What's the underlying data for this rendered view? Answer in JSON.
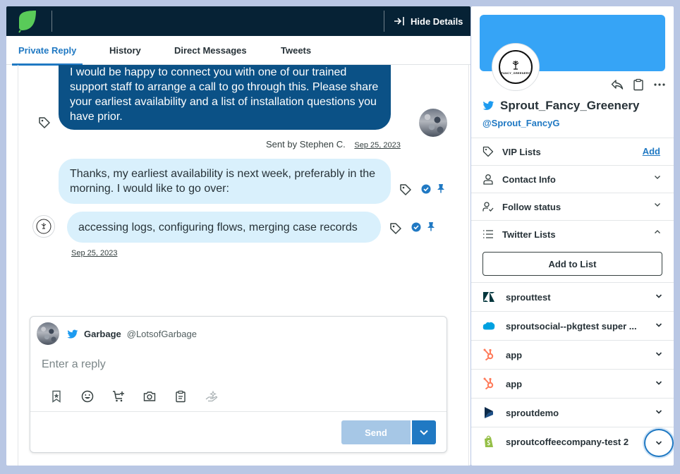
{
  "topbar": {
    "hide_details": "Hide Details"
  },
  "tabs": [
    {
      "label": "Private Reply",
      "active": true
    },
    {
      "label": "History"
    },
    {
      "label": "Direct Messages"
    },
    {
      "label": "Tweets"
    }
  ],
  "messages": {
    "outgoing": {
      "text": "I would be happy to connect you with one of our trained support staff to arrange a call to go through this. Please share your earliest availability and a list of installation questions you have prior.",
      "sent_by": "Sent by Stephen C.",
      "date": "Sep 25, 2023"
    },
    "incoming_1": {
      "text": "Thanks, my earliest availability is next week, preferably in the morning. I would like to go over:"
    },
    "incoming_2": {
      "text": "accessing logs, configuring flows, merging case records",
      "date": "Sep 25, 2023"
    }
  },
  "reply": {
    "name": "Garbage",
    "handle": "@LotsofGarbage",
    "placeholder": "Enter a reply",
    "send_label": "Send"
  },
  "profile": {
    "name": "Sprout_Fancy_Greenery",
    "handle": "@Sprout_FancyG",
    "avatar_text": "FANCY_GREENERY"
  },
  "sections": {
    "vip_lists": "VIP Lists",
    "vip_add": "Add",
    "contact_info": "Contact Info",
    "follow_status": "Follow status",
    "twitter_lists": "Twitter Lists",
    "add_to_list": "Add to List"
  },
  "integrations": [
    {
      "name": "sprouttest",
      "icon": "zendesk-icon"
    },
    {
      "name": "sproutsocial--pkgtest super ...",
      "icon": "salesforce-icon"
    },
    {
      "name": "app",
      "icon": "hubspot-icon"
    },
    {
      "name": "app",
      "icon": "hubspot-icon"
    },
    {
      "name": "sproutdemo",
      "icon": "dynamics-icon"
    },
    {
      "name": "sproutcoffeecompany-test 2",
      "icon": "shopify-icon"
    }
  ],
  "colors": {
    "navy": "#062235",
    "accent": "#2079c3",
    "outgoing_bubble": "#0b5186",
    "incoming_bubble": "#d9f0fc",
    "twitter": "#1d9bf0",
    "cover": "#36a4f6"
  }
}
